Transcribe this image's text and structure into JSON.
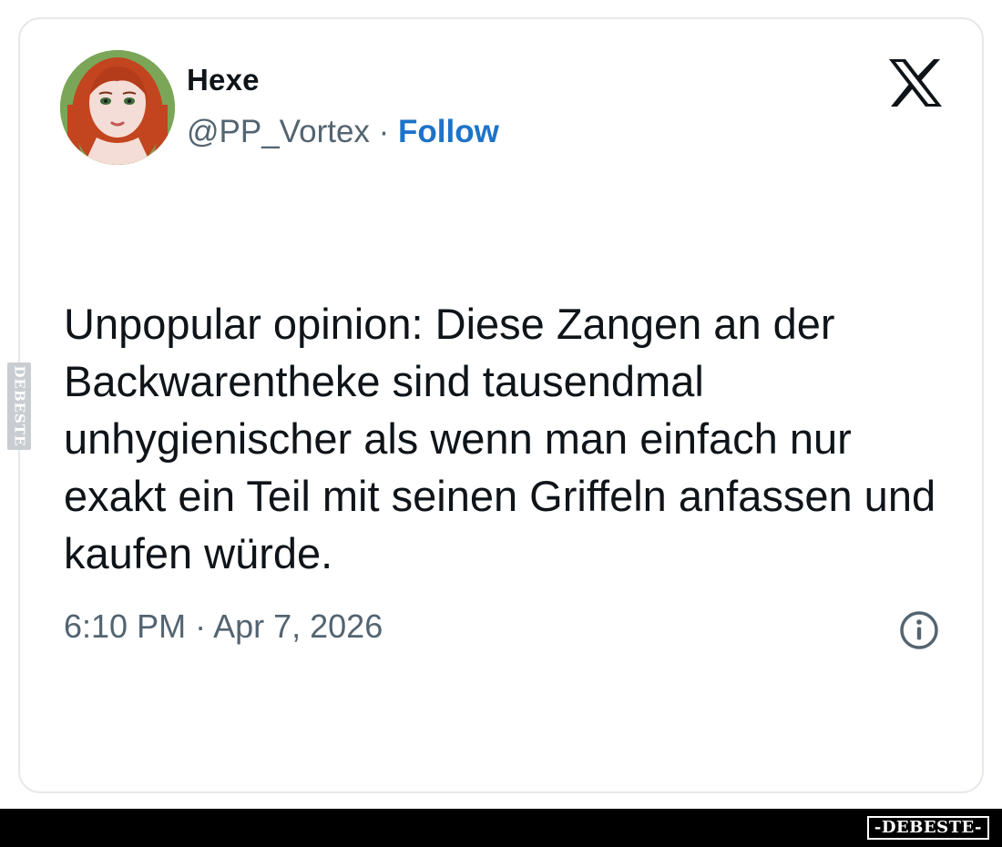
{
  "tweet": {
    "display_name": "Hexe",
    "handle": "@PP_Vortex",
    "separator": " · ",
    "follow_label": "Follow",
    "text": "Unpopular opinion: Diese Zangen an der Backwarentheke sind tausendmal unhygienischer als wenn man einfach nur exakt ein Teil mit seinen Griffeln anfassen und kaufen würde.",
    "timestamp": "6:10 PM · Apr 7, 2026"
  },
  "icons": {
    "platform_logo": "x-logo-icon",
    "info": "info-icon",
    "avatar": "avatar-red-haired-woman"
  },
  "watermark": {
    "side_text": "DEBESTE",
    "brand_text": "-DEBESTE-"
  },
  "colors": {
    "text_primary": "#0f1419",
    "text_secondary": "#536471",
    "follow_link": "#1d73c9",
    "card_border": "#e6e8eb",
    "bottom_bar": "#000000"
  }
}
